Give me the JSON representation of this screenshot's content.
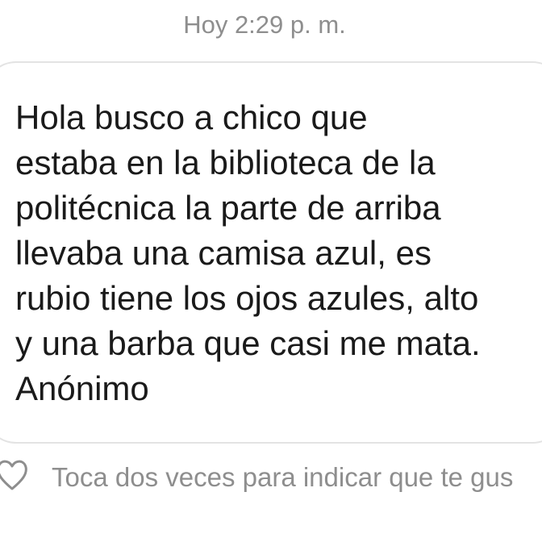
{
  "thread": {
    "timestamp": "Hoy 2:29 p. m."
  },
  "message": {
    "lines": [
      "Hola busco a chico que",
      "estaba en la biblioteca de la",
      "politécnica la parte de arriba",
      "llevaba una camisa azul, es",
      "rubio tiene los ojos azules, alto",
      "y una barba que casi me mata.",
      "Anónimo"
    ]
  },
  "reaction": {
    "icon": "heart-outline-icon",
    "hint": "Toca dos veces para indicar que te gus"
  },
  "colors": {
    "secondary_text": "#8e8e8e",
    "bubble_border": "#e3e3e3",
    "message_text": "#1a1a1a"
  }
}
